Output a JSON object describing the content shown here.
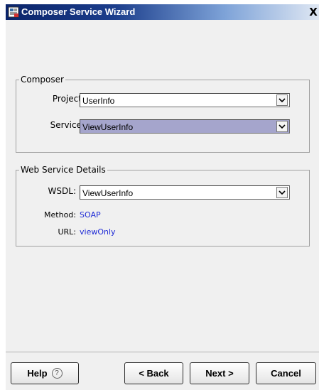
{
  "window": {
    "title": "Composer Service Wizard",
    "close_label": "X"
  },
  "composer_group": {
    "legend": "Composer",
    "project": {
      "label": "Project:",
      "value": "UserInfo"
    },
    "service": {
      "label": "Service:",
      "value": "ViewUserInfo"
    }
  },
  "web_service_group": {
    "legend": "Web Service Details",
    "wsdl": {
      "label": "WSDL:",
      "value": "ViewUserInfo"
    },
    "method": {
      "label": "Method:",
      "value": "SOAP"
    },
    "url": {
      "label": "URL:",
      "value": "viewOnly"
    }
  },
  "buttons": {
    "help": "Help",
    "back": "< Back",
    "next": "Next >",
    "cancel": "Cancel"
  },
  "icons": {
    "app": "wizard-app-icon",
    "dropdown": "chevron-down-icon",
    "help": "help-circle-icon"
  },
  "colors": {
    "titlebar_start": "#0a246a",
    "selected_combo": "#a5a5cc",
    "link_text": "#1f2bd6"
  }
}
